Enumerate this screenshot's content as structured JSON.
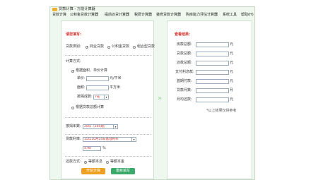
{
  "window": {
    "title": "贷款计算 - 万能计算器"
  },
  "menu": [
    "贷款计算",
    "公积金贷款计算器",
    "提前还贷计算器",
    "税费计算器",
    "装修贷款计算器",
    "购房能力评估计算器",
    "系统工具",
    "帮助(H)"
  ],
  "form": {
    "title": "请您填写:",
    "loan_type_label": "贷款类别:",
    "loan_types": [
      "商业贷款",
      "公积金贷款",
      "组合型贷款"
    ],
    "method_label": "计算方式:",
    "method_area_option": "根据面积、单价计算",
    "price_label": "单价:",
    "price_unit": "元/平米",
    "area_label": "面积:",
    "area_unit": "平方米",
    "ratio_label": "按揭成数:",
    "ratio_value": "7成",
    "method_total_option": "根据贷款总额计算",
    "years_label": "按揭年数:",
    "years_value": "20年（240期）",
    "rate_label": "贷款利率:",
    "rate_select": "15年10月24日基准利率",
    "rate_value": "4.90",
    "rate_unit": "%",
    "repay_label": "还款方式:",
    "repay_options": [
      "等额本息",
      "等额本金"
    ],
    "calc_button": "开始计算",
    "reset_button": "重新填写"
  },
  "result": {
    "title": "查看结果:",
    "rows": [
      {
        "label": "房款总额:",
        "unit": "元"
      },
      {
        "label": "贷款总额:",
        "unit": "元"
      },
      {
        "label": "还款总额:",
        "unit": "元"
      },
      {
        "label": "支付利息款:",
        "unit": "元"
      },
      {
        "label": "首期付款:",
        "unit": "元"
      },
      {
        "label": "贷款月数:",
        "unit": "月"
      },
      {
        "label": "月均还款:",
        "unit": "元"
      }
    ],
    "note": "*以上结果仅供参考"
  },
  "colors": {
    "accent_red": "#d2322d",
    "calc_button": "#f0a020",
    "reset_button": "#3aaa6a",
    "window_bg": "#eef8ef"
  }
}
